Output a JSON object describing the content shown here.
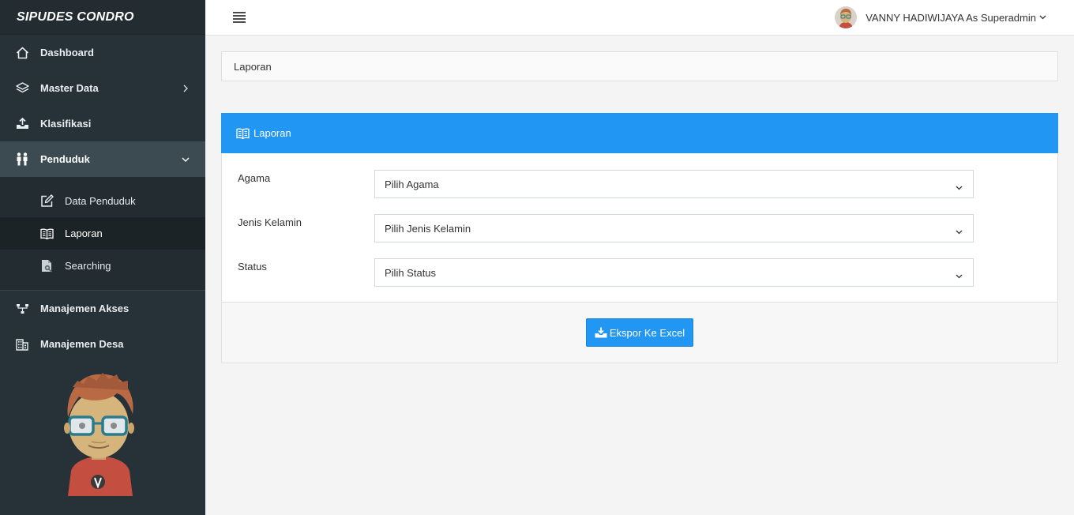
{
  "brand": {
    "title": "SIPUDES CONDRO"
  },
  "sidebar": {
    "items": [
      {
        "label": "Dashboard",
        "icon": "home-icon"
      },
      {
        "label": "Master Data",
        "icon": "layers-icon"
      },
      {
        "label": "Klasifikasi",
        "icon": "upload-tray-icon"
      },
      {
        "label": "Penduduk",
        "icon": "people-icon"
      },
      {
        "label": "Manajemen Akses",
        "icon": "network-icon"
      },
      {
        "label": "Manajemen Desa",
        "icon": "building-icon"
      }
    ],
    "submenu": [
      {
        "label": "Data Penduduk",
        "icon": "edit-icon"
      },
      {
        "label": "Laporan",
        "icon": "book-icon"
      },
      {
        "label": "Searching",
        "icon": "search-document-icon"
      }
    ]
  },
  "topbar": {
    "user_label": "VANNY HADIWIJAYA As Superadmin"
  },
  "breadcrumb": {
    "label": "Laporan"
  },
  "panel": {
    "title": "Laporan",
    "fields": [
      {
        "label": "Agama",
        "value": "Pilih Agama"
      },
      {
        "label": "Jenis Kelamin",
        "value": "Pilih Jenis Kelamin"
      },
      {
        "label": "Status",
        "value": "Pilih Status"
      }
    ],
    "export_label": "Ekspor Ke Excel"
  },
  "colors": {
    "primary": "#2196f3",
    "sidebar": "#273238",
    "sidebar_active": "#3c4a52"
  }
}
